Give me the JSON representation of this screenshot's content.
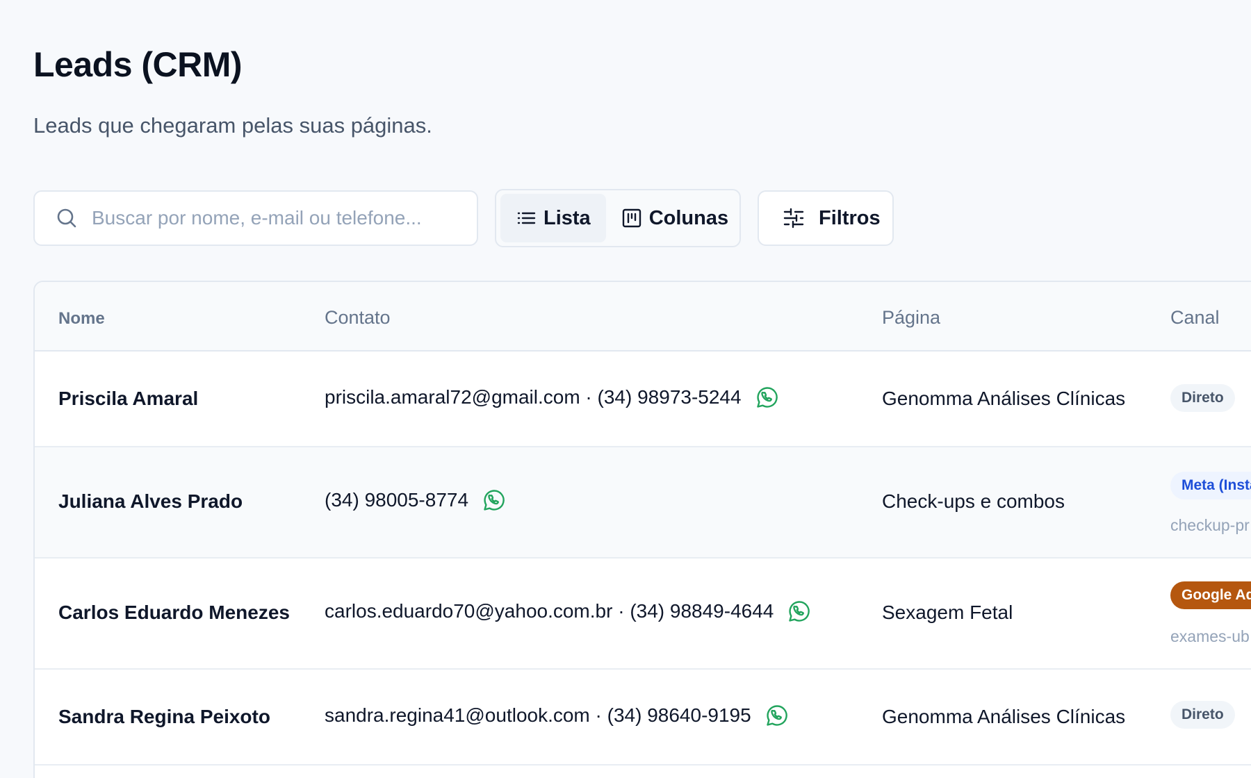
{
  "page": {
    "title": "Leads (CRM)",
    "subtitle": "Leads que chegaram pelas suas páginas."
  },
  "toolbar": {
    "search_placeholder": "Buscar por nome, e-mail ou telefone...",
    "search_value": "",
    "view_list_label": "Lista",
    "view_columns_label": "Colunas",
    "active_view": "Lista",
    "filters_label": "Filtros"
  },
  "table": {
    "headers": {
      "name": "Nome",
      "contact": "Contato",
      "page": "Página",
      "channel": "Canal"
    },
    "rows": [
      {
        "name": "Priscila Amaral",
        "contact": "priscila.amaral72@gmail.com · (34) 98973-5244",
        "page": "Genomma Análises Clínicas",
        "channel": "Direto",
        "channel_type": "direto",
        "slug": ""
      },
      {
        "name": "Juliana Alves Prado",
        "contact": "(34) 98005-8774",
        "page": "Check-ups e combos",
        "channel": "Meta (Insta",
        "channel_type": "meta",
        "slug": "checkup-pr"
      },
      {
        "name": "Carlos Eduardo Menezes",
        "contact": "carlos.eduardo70@yahoo.com.br · (34) 98849-4644",
        "page": "Sexagem Fetal",
        "channel": "Google Ad",
        "channel_type": "google",
        "slug": "exames-ub"
      },
      {
        "name": "Sandra Regina Peixoto",
        "contact": "sandra.regina41@outlook.com · (34) 98640-9195",
        "page": "Genomma Análises Clínicas",
        "channel": "Direto",
        "channel_type": "direto",
        "slug": ""
      }
    ]
  },
  "colors": {
    "whatsapp": "#22a45d",
    "badge_google_bg": "#b5570f",
    "badge_meta_text": "#1d4ed8"
  },
  "icons": {
    "search": "search-icon",
    "list": "list-icon",
    "columns": "kanban-icon",
    "filters": "sliders-icon",
    "whatsapp": "whatsapp-icon"
  }
}
